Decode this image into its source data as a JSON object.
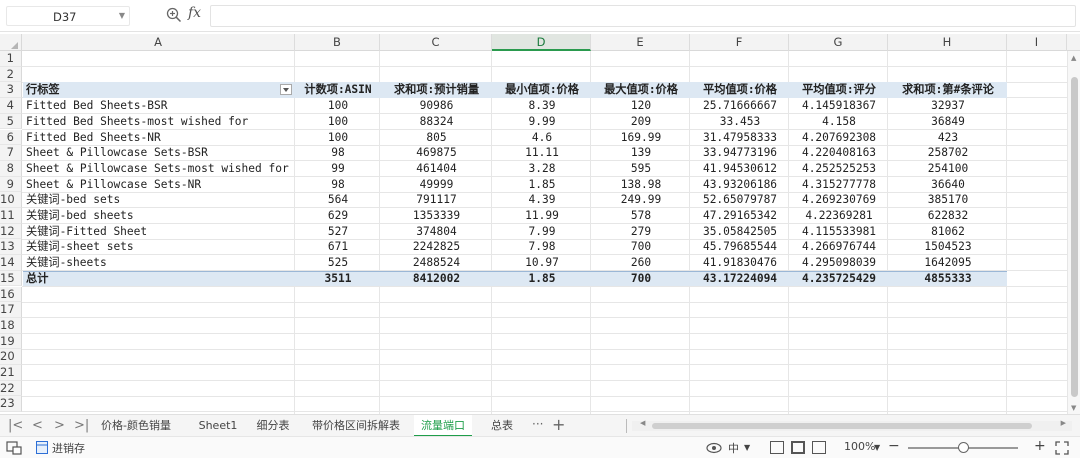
{
  "formula_bar": {
    "name_box": "D37",
    "fx": "fx",
    "formula": ""
  },
  "columns": [
    "A",
    "B",
    "C",
    "D",
    "E",
    "F",
    "G",
    "H",
    "I"
  ],
  "selected_column": "D",
  "rows": [
    "1",
    "2",
    "3",
    "4",
    "5",
    "6",
    "7",
    "8",
    "9",
    "10",
    "11",
    "12",
    "13",
    "14",
    "15",
    "16",
    "17",
    "18",
    "19",
    "20",
    "21",
    "22",
    "23"
  ],
  "pivot": {
    "headers": [
      "行标签",
      "计数项:ASIN",
      "求和项:预计销量",
      "最小值项:价格",
      "最大值项:价格",
      "平均值项:价格",
      "平均值项:评分",
      "求和项:第#条评论"
    ],
    "data": [
      [
        "Fitted Bed Sheets-BSR",
        "100",
        "90986",
        "8.39",
        "120",
        "25.71666667",
        "4.145918367",
        "32937"
      ],
      [
        "Fitted Bed Sheets-most wished for",
        "100",
        "88324",
        "9.99",
        "209",
        "33.453",
        "4.158",
        "36849"
      ],
      [
        "Fitted Bed Sheets-NR",
        "100",
        "805",
        "4.6",
        "169.99",
        "31.47958333",
        "4.207692308",
        "423"
      ],
      [
        "Sheet & Pillowcase Sets-BSR",
        "98",
        "469875",
        "11.11",
        "139",
        "33.94773196",
        "4.220408163",
        "258702"
      ],
      [
        "Sheet & Pillowcase Sets-most wished for",
        "99",
        "461404",
        "3.28",
        "595",
        "41.94530612",
        "4.252525253",
        "254100"
      ],
      [
        "Sheet & Pillowcase Sets-NR",
        "98",
        "49999",
        "1.85",
        "138.98",
        "43.93206186",
        "4.315277778",
        "36640"
      ],
      [
        "关键词-bed sets",
        "564",
        "791117",
        "4.39",
        "249.99",
        "52.65079787",
        "4.269230769",
        "385170"
      ],
      [
        "关键词-bed sheets",
        "629",
        "1353339",
        "11.99",
        "578",
        "47.29165342",
        "4.22369281",
        "622832"
      ],
      [
        "关键词-Fitted Sheet",
        "527",
        "374804",
        "7.99",
        "279",
        "35.05842505",
        "4.115533981",
        "81062"
      ],
      [
        "关键词-sheet sets",
        "671",
        "2242825",
        "7.98",
        "700",
        "45.79685544",
        "4.266976744",
        "1504523"
      ],
      [
        "关键词-sheets",
        "525",
        "2488524",
        "10.97",
        "260",
        "41.91830476",
        "4.295098039",
        "1642095"
      ]
    ],
    "total": [
      "总计",
      "3511",
      "8412002",
      "1.85",
      "700",
      "43.17224094",
      "4.235725429",
      "4855333"
    ]
  },
  "sheet_tabs": [
    {
      "label": "价格-颜色销量",
      "active": false
    },
    {
      "label": "Sheet1",
      "active": false
    },
    {
      "label": "细分表",
      "active": false
    },
    {
      "label": "带价格区间拆解表",
      "active": false
    },
    {
      "label": "流量端口",
      "active": true
    },
    {
      "label": "总表",
      "active": false
    }
  ],
  "tab_more": "···",
  "tab_add": "+",
  "status": {
    "macro_label": "进销存",
    "zoom": "100%",
    "zoom_minus": "−",
    "zoom_plus": "+",
    "input_mode": "中"
  },
  "colors": {
    "accent": "#1f9e4a",
    "pivot_band": "#dde8f3"
  }
}
